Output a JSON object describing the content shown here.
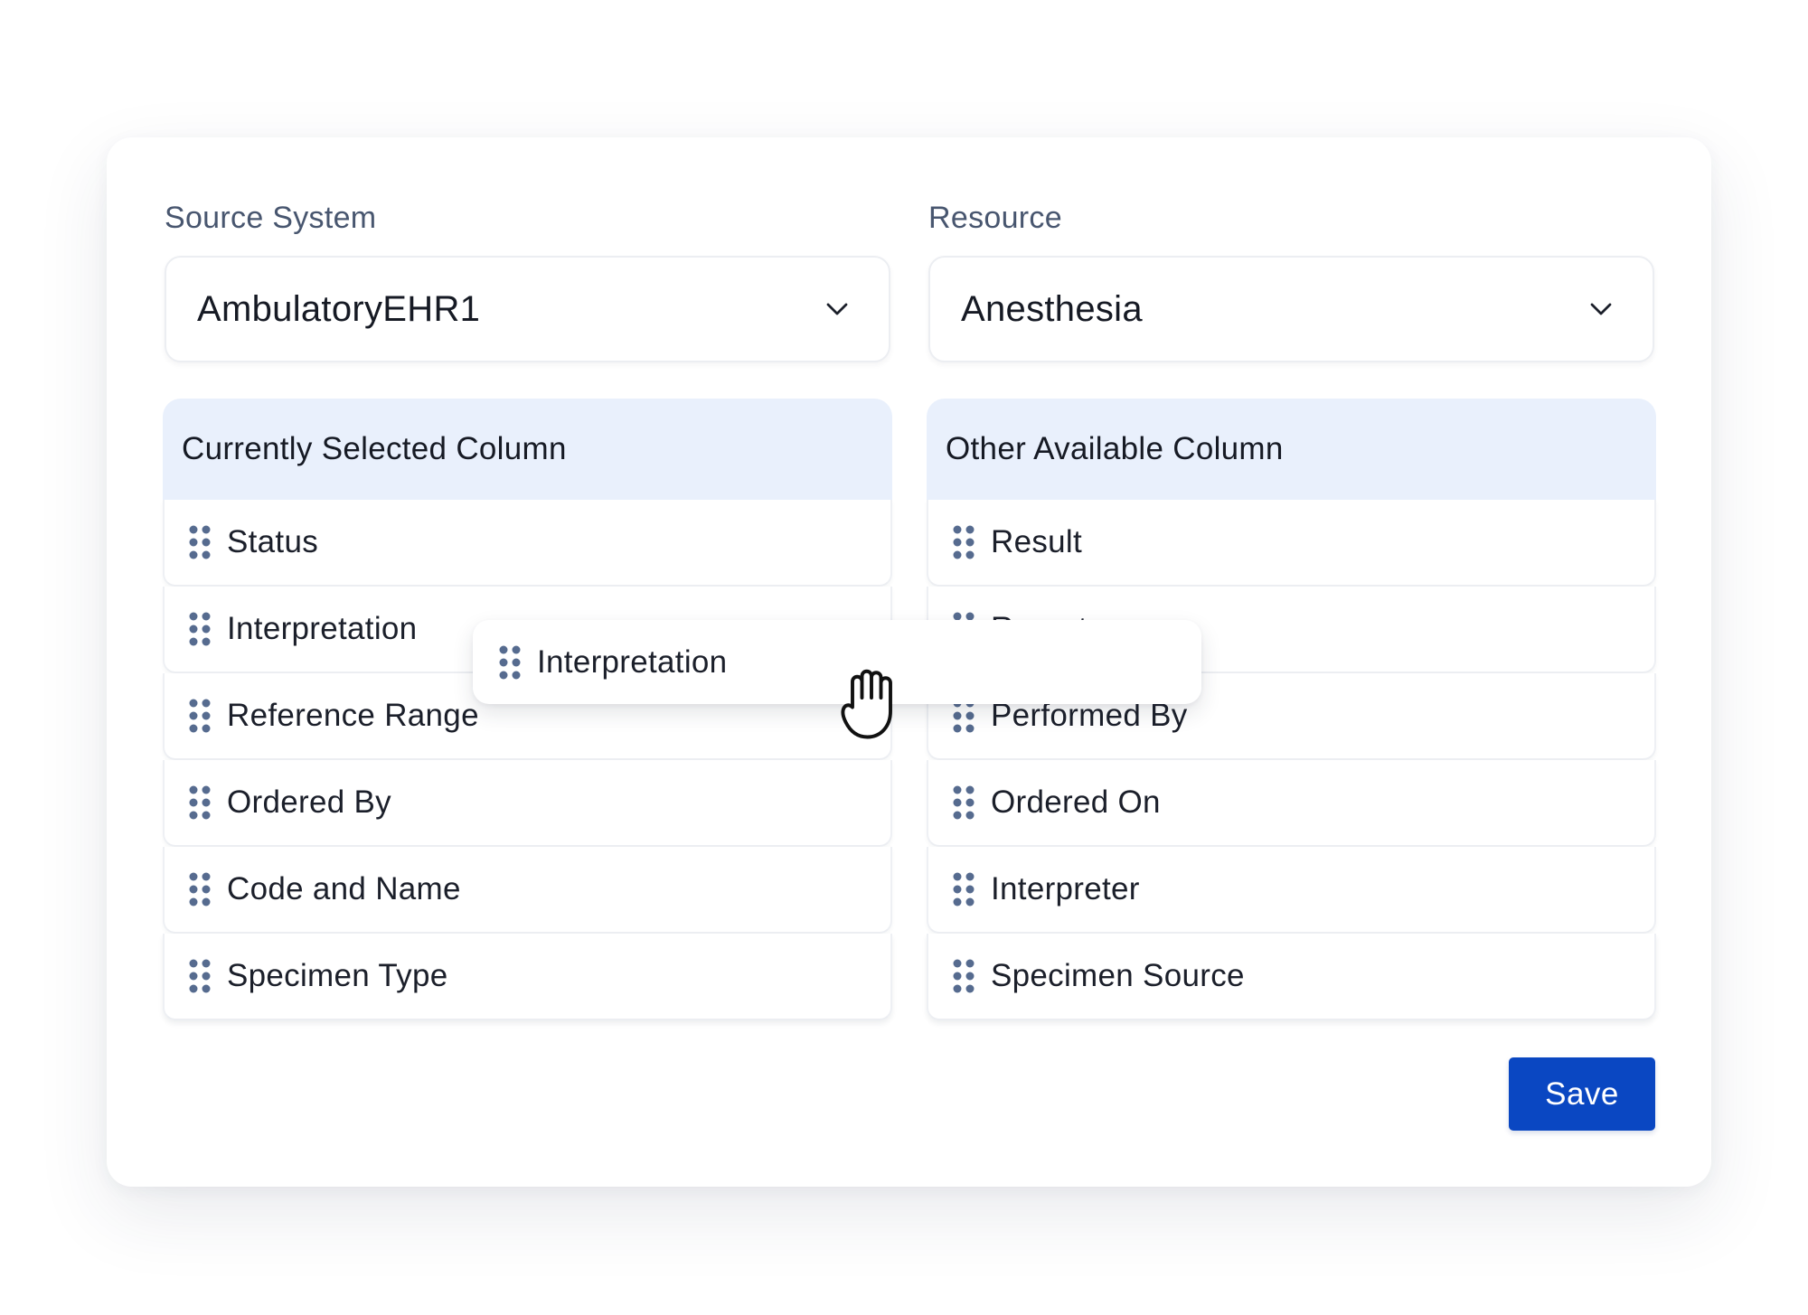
{
  "source_system": {
    "label": "Source System",
    "value": "AmbulatoryEHR1"
  },
  "resource": {
    "label": "Resource",
    "value": "Anesthesia"
  },
  "selected_columns": {
    "title": "Currently Selected Column",
    "items": [
      "Status",
      "Interpretation",
      "Reference Range",
      "Ordered By",
      "Code and Name",
      "Specimen Type"
    ]
  },
  "available_columns": {
    "title": "Other Available Column",
    "items": [
      "Result",
      "Report",
      "Performed By",
      "Ordered On",
      "Interpreter",
      "Specimen Source"
    ]
  },
  "drag_ghost": {
    "label": "Interpretation",
    "cursor": "grab-hand-icon"
  },
  "actions": {
    "save_label": "Save"
  },
  "colors": {
    "primary": "#0a47c2",
    "panel_header": "#e9f0fc",
    "grip": "#566b8f"
  }
}
